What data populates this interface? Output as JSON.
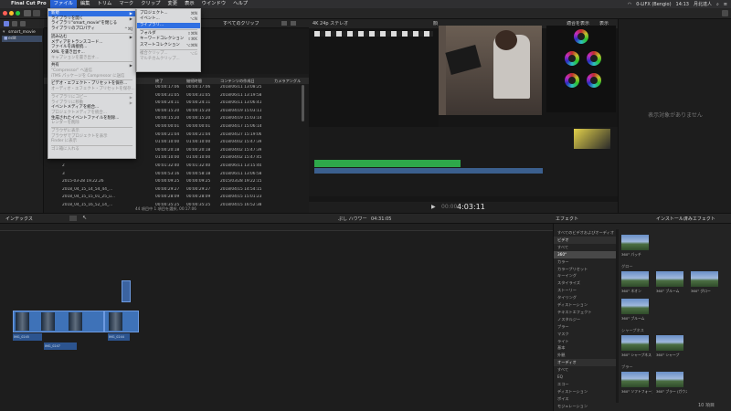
{
  "menubar": {
    "apple": "",
    "items": [
      "Final Cut Pro",
      "ファイル",
      "編集",
      "トリム",
      "マーク",
      "クリップ",
      "変更",
      "表示",
      "ウインドウ",
      "ヘルプ"
    ],
    "status": [
      "0-LIFX (Bengio)",
      "14:13",
      "月北達人"
    ]
  },
  "library": {
    "items": [
      "smart_movie",
      "edit"
    ]
  },
  "browser": {
    "filter_label": "すべてのクリップ",
    "columns": [
      "終了",
      "継続時間",
      "コンテンツの作成日",
      "カメラアングル"
    ],
    "rows": [
      {
        "name": "",
        "end": "00:00:17:06",
        "dur": "00:00:17:06",
        "date": "2018/06/11 13:08:25"
      },
      {
        "name": "",
        "end": "00:04:31:05",
        "dur": "00:04:31:05",
        "date": "2018/06/11 13:19:58"
      },
      {
        "name": "",
        "end": "00:00:24:11",
        "dur": "00:00:24:11",
        "date": "2018/06/11 13:06:41"
      },
      {
        "name": "",
        "end": "00:00:15:20",
        "dur": "00:00:15:20",
        "date": "2018/04/19 15:03:11"
      },
      {
        "name": "",
        "end": "00:00:15:20",
        "dur": "00:00:15:20",
        "date": "2018/04/19 15:03:14"
      },
      {
        "name": "",
        "end": "00:00:00:01",
        "dur": "00:00:00:01",
        "date": "2018/04/17 15:06:14"
      },
      {
        "name": "",
        "end": "00:00:21:04",
        "dur": "00:00:21:04",
        "date": "2018/04/27 15:19:06"
      },
      {
        "name": "",
        "end": "01:00:10:00",
        "dur": "01:00:10:00",
        "date": "2018/04/02 15:47:39"
      },
      {
        "name": "",
        "end": "00:00:20:18",
        "dur": "00:00:20:18",
        "date": "2018/04/02 15:47:39"
      },
      {
        "name": "",
        "end": "01:00:10:00",
        "dur": "01:00:10:00",
        "date": "2018/04/02 15:47:45"
      },
      {
        "name": "2",
        "end": "00:01:32:40",
        "dur": "00:01:32:40",
        "date": "2018/06/11 13:15:40"
      },
      {
        "name": "3",
        "end": "00:00:53:16",
        "dur": "00:00:58:18",
        "date": "2018/06/11 13:06:58"
      },
      {
        "name": "2015-03-28 19.22.26",
        "end": "00:00:09:25",
        "dur": "00:00:09:25",
        "date": "2015/03/28 19:22:15"
      },
      {
        "name": "2018_04_15_14_54_44_...",
        "end": "00:00:29:27",
        "dur": "00:00:29:27",
        "date": "2018/04/15 14:54:15"
      },
      {
        "name": "2018_04_15_15_01_25_u...",
        "end": "00:00:28:09",
        "dur": "00:00:28:09",
        "date": "2018/04/15 15:01:23"
      },
      {
        "name": "2018_04_15_16_52_14_...",
        "end": "00:00:35:25",
        "dur": "00:00:35:25",
        "date": "2018/04/15 16:52:38"
      }
    ],
    "footer": "44 項目中 1 項目を選択, 00:17:06"
  },
  "viewer": {
    "format": "4K 24p ステレオ",
    "title": "顔",
    "zoom": "適合を表示",
    "view": "表示",
    "timecode": "4:03:11",
    "timecode_prefix": "00:00"
  },
  "inspector": {
    "empty": "表示対象がありません"
  },
  "timeline_bar": {
    "index": "インデックス",
    "project": "ぷし ハウワー",
    "duration": "04:31:05",
    "effects": "エフェクト",
    "installed": "インストール済みエフェクト"
  },
  "effects": {
    "categories": [
      {
        "label": "すべてのビデオおよびオーディオ",
        "type": "cat"
      },
      {
        "label": "ビデオ",
        "type": "hdr"
      },
      {
        "label": "すべて",
        "type": "cat"
      },
      {
        "label": "360°",
        "type": "sel"
      },
      {
        "label": "カラー",
        "type": "cat"
      },
      {
        "label": "カラープリセット",
        "type": "cat"
      },
      {
        "label": "キーイング",
        "type": "cat"
      },
      {
        "label": "スタイライズ",
        "type": "cat"
      },
      {
        "label": "ストーリー",
        "type": "cat"
      },
      {
        "label": "タイリング",
        "type": "cat"
      },
      {
        "label": "ディストーション",
        "type": "cat"
      },
      {
        "label": "テキストエフェクト",
        "type": "cat"
      },
      {
        "label": "ノスタルジー",
        "type": "cat"
      },
      {
        "label": "ブラー",
        "type": "cat"
      },
      {
        "label": "マスク",
        "type": "cat"
      },
      {
        "label": "ライト",
        "type": "cat"
      },
      {
        "label": "基本",
        "type": "cat"
      },
      {
        "label": "外観",
        "type": "cat"
      },
      {
        "label": "オーディオ",
        "type": "hdr"
      },
      {
        "label": "すべて",
        "type": "cat"
      },
      {
        "label": "EQ",
        "type": "cat"
      },
      {
        "label": "エコー",
        "type": "cat"
      },
      {
        "label": "ディストーション",
        "type": "cat"
      },
      {
        "label": "ボイス",
        "type": "cat"
      },
      {
        "label": "モジュレーション",
        "type": "cat"
      }
    ],
    "groups": [
      {
        "title": "",
        "items": [
          "360° パッチ"
        ]
      },
      {
        "title": "グロー",
        "items": [
          "360° ネオン",
          "360° ブルーム",
          "360° グロー",
          "360° ブルーム"
        ]
      },
      {
        "title": "シャープネス",
        "items": [
          "360° シャープネス",
          "360° シャープ"
        ]
      },
      {
        "title": "ブラー",
        "items": [
          "360° ソフトフォーカス",
          "360° ブラー (ガウス)"
        ]
      }
    ],
    "count": "10 項目"
  },
  "menu_file": {
    "items": [
      {
        "label": "新規",
        "shortcut": "▶",
        "state": "hl"
      },
      {
        "label": "ライブラリを開く",
        "shortcut": "▶",
        "state": "en"
      },
      {
        "label": "ライブラリ\"smart_movie\"を閉じる",
        "shortcut": "",
        "state": "en"
      },
      {
        "label": "ライブラリのプロパティ",
        "shortcut": "^⌘J",
        "state": "en"
      },
      {
        "label": "sep"
      },
      {
        "label": "読み込む",
        "shortcut": "▶",
        "state": "en"
      },
      {
        "label": "メディアをトランスコード...",
        "shortcut": "",
        "state": "en"
      },
      {
        "label": "ファイルを再接続...",
        "shortcut": "",
        "state": "en"
      },
      {
        "label": "XML を書き出す...",
        "shortcut": "",
        "state": "en"
      },
      {
        "label": "キャプションを書き出す...",
        "shortcut": "",
        "state": "dis"
      },
      {
        "label": "sep"
      },
      {
        "label": "共有",
        "shortcut": "▶",
        "state": "en"
      },
      {
        "label": "\"Compressor\" へ送信",
        "shortcut": "",
        "state": "dis"
      },
      {
        "label": "iTMS パッケージを Compressor に送信",
        "shortcut": "",
        "state": "dis"
      },
      {
        "label": "sep"
      },
      {
        "label": "ビデオ・エフェクト・プリセットを保存...",
        "shortcut": "",
        "state": "en"
      },
      {
        "label": "オーディオ・エフェクト・プリセットを保存...",
        "shortcut": "",
        "state": "dis"
      },
      {
        "label": "sep"
      },
      {
        "label": "ライブラリにコピー",
        "shortcut": "▶",
        "state": "dis"
      },
      {
        "label": "ライブラリに移動",
        "shortcut": "▶",
        "state": "dis"
      },
      {
        "label": "イベントメディアを統合...",
        "shortcut": "",
        "state": "en"
      },
      {
        "label": "プロジェクトメディアを統合...",
        "shortcut": "",
        "state": "dis"
      },
      {
        "label": "生成されたイベントファイルを削除...",
        "shortcut": "",
        "state": "en"
      },
      {
        "label": "レンダーを削除",
        "shortcut": "",
        "state": "dis"
      },
      {
        "label": "sep"
      },
      {
        "label": "ブラウザに表示",
        "shortcut": "",
        "state": "dis"
      },
      {
        "label": "ブラウザでプロジェクトを表示",
        "shortcut": "",
        "state": "dis"
      },
      {
        "label": "Finder に表示",
        "shortcut": "",
        "state": "dis"
      },
      {
        "label": "sep"
      },
      {
        "label": "ゴミ箱に入れる",
        "shortcut": "",
        "state": "dis"
      }
    ]
  },
  "menu_new": {
    "items": [
      {
        "label": "プロジェクト...",
        "shortcut": "⌘N",
        "state": "en"
      },
      {
        "label": "イベント...",
        "shortcut": "⌥N",
        "state": "en"
      },
      {
        "label": "ライブラリ...",
        "shortcut": "",
        "state": "hl"
      },
      {
        "label": "sep"
      },
      {
        "label": "フォルダ",
        "shortcut": "⇧⌘N",
        "state": "en"
      },
      {
        "label": "キーワードコレクション",
        "shortcut": "⇧⌘K",
        "state": "en"
      },
      {
        "label": "スマートコレクション",
        "shortcut": "⌥⌘N",
        "state": "en"
      },
      {
        "label": "sep"
      },
      {
        "label": "複合クリップ...",
        "shortcut": "⌥G",
        "state": "dis"
      },
      {
        "label": "マルチカムクリップ...",
        "shortcut": "",
        "state": "dis"
      }
    ]
  },
  "timeline_clips": {
    "labels": [
      "IMG_0245",
      "IMG_0247",
      "IMG_0244"
    ]
  }
}
